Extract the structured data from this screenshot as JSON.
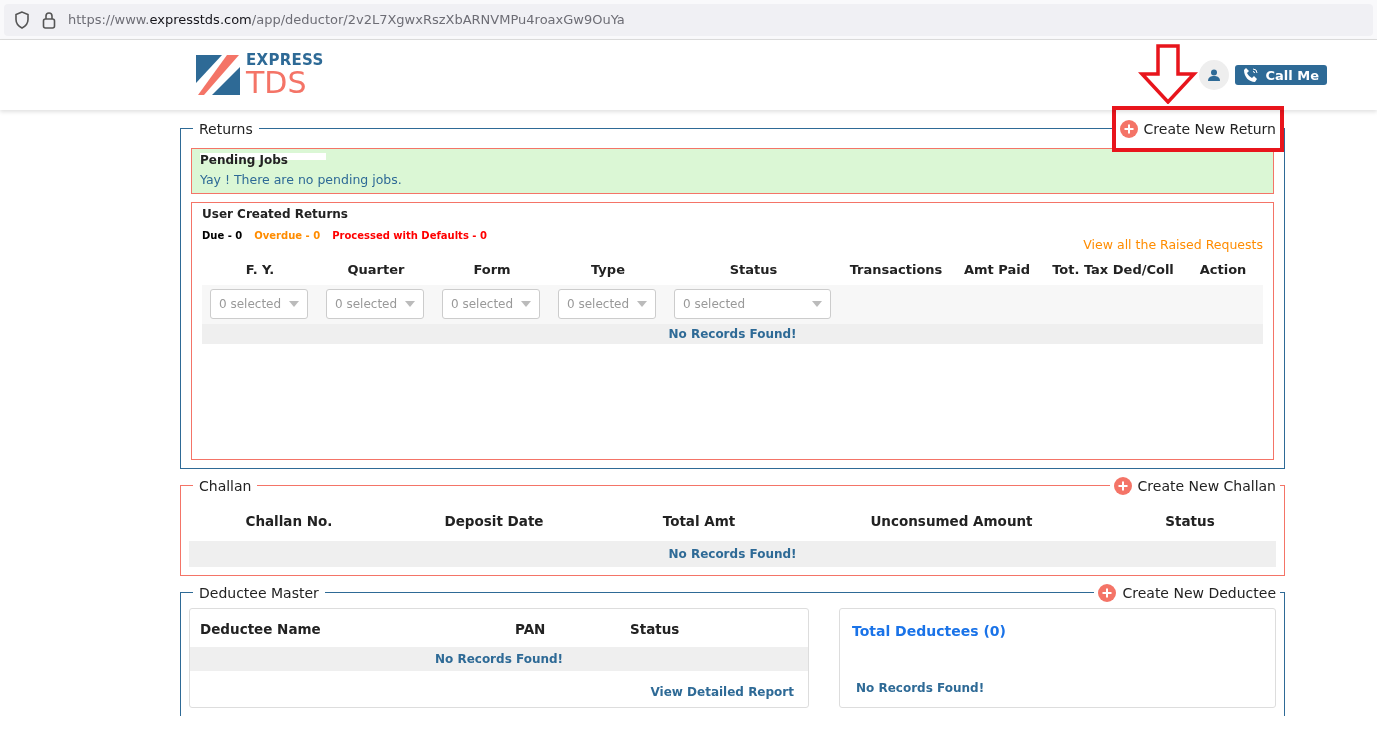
{
  "browser": {
    "url_prefix": "https://www.",
    "url_domain": "expresstds.com",
    "url_path": "/app/deductor/2v2L7XgwxRszXbARNVMPu4roaxGw9OuYa"
  },
  "header": {
    "logo_top": "EXPRESS",
    "logo_bottom": "TDS",
    "call_button": "Call Me"
  },
  "returns": {
    "title": "Returns",
    "create_button": "Create New Return",
    "highlighted": true,
    "pending": {
      "title": "Pending Jobs",
      "message": "Yay ! There are no pending jobs."
    },
    "user_created": {
      "title": "User Created Returns",
      "counts": [
        {
          "label": "Due - 0",
          "color": "#000000"
        },
        {
          "label": "Overdue - 0",
          "color": "#ff8c00"
        },
        {
          "label": "Processed with Defaults - 0",
          "color": "#ff0000"
        }
      ],
      "raised_link": "View all the Raised Requests",
      "columns": [
        "F. Y.",
        "Quarter",
        "Form",
        "Type",
        "Status",
        "Transactions",
        "Amt Paid",
        "Tot. Tax Ded/Coll",
        "Action"
      ],
      "filters": [
        {
          "placeholder": "0 selected"
        },
        {
          "placeholder": "0 selected"
        },
        {
          "placeholder": "0 selected"
        },
        {
          "placeholder": "0 selected"
        },
        {
          "placeholder": "0 selected"
        }
      ],
      "empty": "No Records Found!"
    }
  },
  "challan": {
    "title": "Challan",
    "create_button": "Create New Challan",
    "highlighted": false,
    "columns": [
      "Challan No.",
      "Deposit Date",
      "Total Amt",
      "Unconsumed Amount",
      "Status"
    ],
    "empty": "No Records Found!"
  },
  "deductee": {
    "title": "Deductee Master",
    "create_button": "Create New Deductee",
    "highlighted": false,
    "columns": [
      "Deductee Name",
      "PAN",
      "Status"
    ],
    "empty": "No Records Found!",
    "report_link": "View Detailed Report",
    "total_title": "Total Deductees (0)",
    "total_empty": "No Records Found!"
  }
}
